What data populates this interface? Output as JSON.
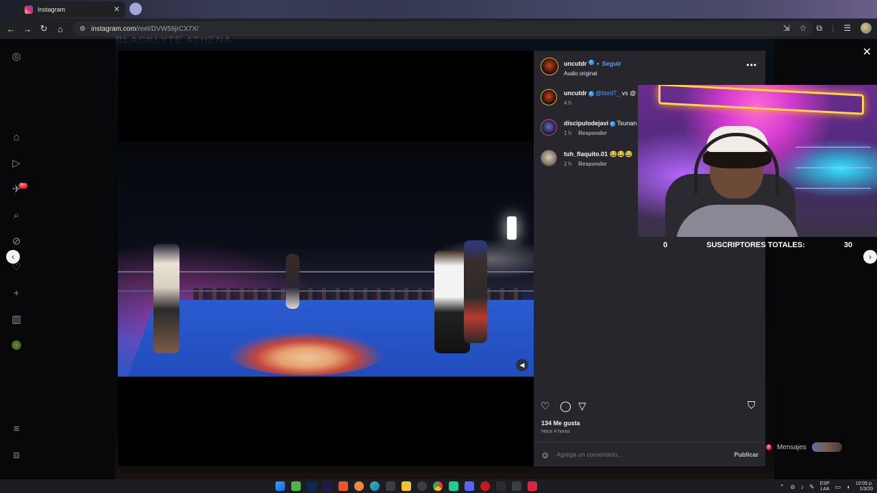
{
  "browser": {
    "tab_title": "Instagram",
    "url_host": "instagram.com",
    "url_path": "/reel/DVW59jrCX7X/"
  },
  "page": {
    "backdrop_title": "BLACKLYTE ATHENA"
  },
  "sidebar": {
    "badge": "9+"
  },
  "post": {
    "author": "uncutdr",
    "follow_label": "Seguir",
    "separator": "•",
    "audio": "Audio original",
    "comments": [
      {
        "user": "uncutdr",
        "text_mention": "@liord7_",
        "text_rest": " vs @",
        "time": "4 h",
        "reply": ""
      },
      {
        "user": "discipulodejavi",
        "text_mention": "",
        "text_rest": "Tsunan",
        "time": "1 h",
        "reply": "Responder"
      },
      {
        "user": "tuh_flaquito.01",
        "text_mention": "",
        "text_rest": "😂😂😂",
        "time": "2 h",
        "reply": "Responder"
      }
    ],
    "likes": "134 Me gusta",
    "time_ago": "Hace 4 horas",
    "comment_placeholder": "Agrega un comentario...",
    "publish_label": "Publicar"
  },
  "messages": {
    "label": "Mensajes",
    "badge": "8"
  },
  "stream_overlay": {
    "left_count": "0",
    "label": "SUSCRIPTORES TOTALES:",
    "right_count": "30"
  },
  "taskbar": {
    "lang_top": "ESP",
    "lang_bottom": "LAA",
    "time": "10:05 p.",
    "date": "1/3/20"
  },
  "icons": {
    "tab_favicon": "instagram-icon",
    "like": "heart-icon",
    "comment": "comment-icon",
    "share": "send-icon",
    "save": "bookmark-icon"
  },
  "colors": {
    "accent_blue": "#4aa3ff",
    "verified": "#3897f0",
    "notification": "#ff3040",
    "panel_bg": "#26262c"
  }
}
